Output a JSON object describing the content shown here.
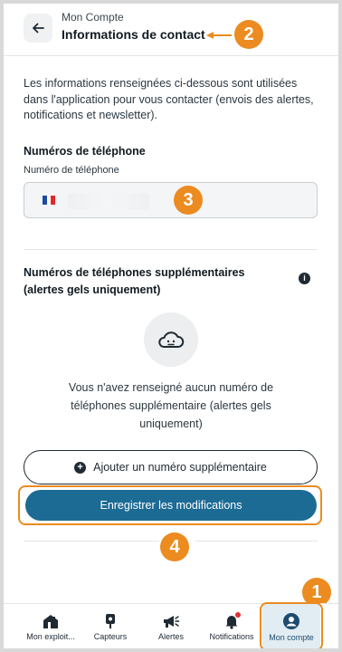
{
  "header": {
    "breadcrumb": "Mon Compte",
    "title": "Informations de contact",
    "back_icon": "arrow-left-icon"
  },
  "callouts": [
    "1",
    "2",
    "3",
    "4"
  ],
  "colors": {
    "accent": "#ec8b1f",
    "primary": "#1c6b95",
    "text": "#1f2a33",
    "badge": "#e0302f"
  },
  "intro_text": "Les informations renseignées ci-dessous sont utilisées dans l'application pour vous contacter (envois des alertes, notifications et newsletter).",
  "phone_section": {
    "title": "Numéros de téléphone",
    "field_label": "Numéro de téléphone",
    "flag_icon": "flag-fr-icon",
    "value": ""
  },
  "extra_section": {
    "title": "Numéros de téléphones supplémentaires (alertes gels uniquement)",
    "info_icon": "info-icon",
    "empty_icon": "cloud-sad-icon",
    "empty_text": "Vous n'avez renseigné aucun numéro de téléphones supplémentaire (alertes gels uniquement)",
    "add_button": "Ajouter un numéro supplémentaire"
  },
  "save_button": "Enregistrer les modifications",
  "tabs": [
    {
      "label": "Mon exploit...",
      "icon": "farm-icon"
    },
    {
      "label": "Capteurs",
      "icon": "sensor-icon"
    },
    {
      "label": "Alertes",
      "icon": "megaphone-icon"
    },
    {
      "label": "Notifications",
      "icon": "bell-icon"
    },
    {
      "label": "Mon compte",
      "icon": "user-icon"
    }
  ]
}
